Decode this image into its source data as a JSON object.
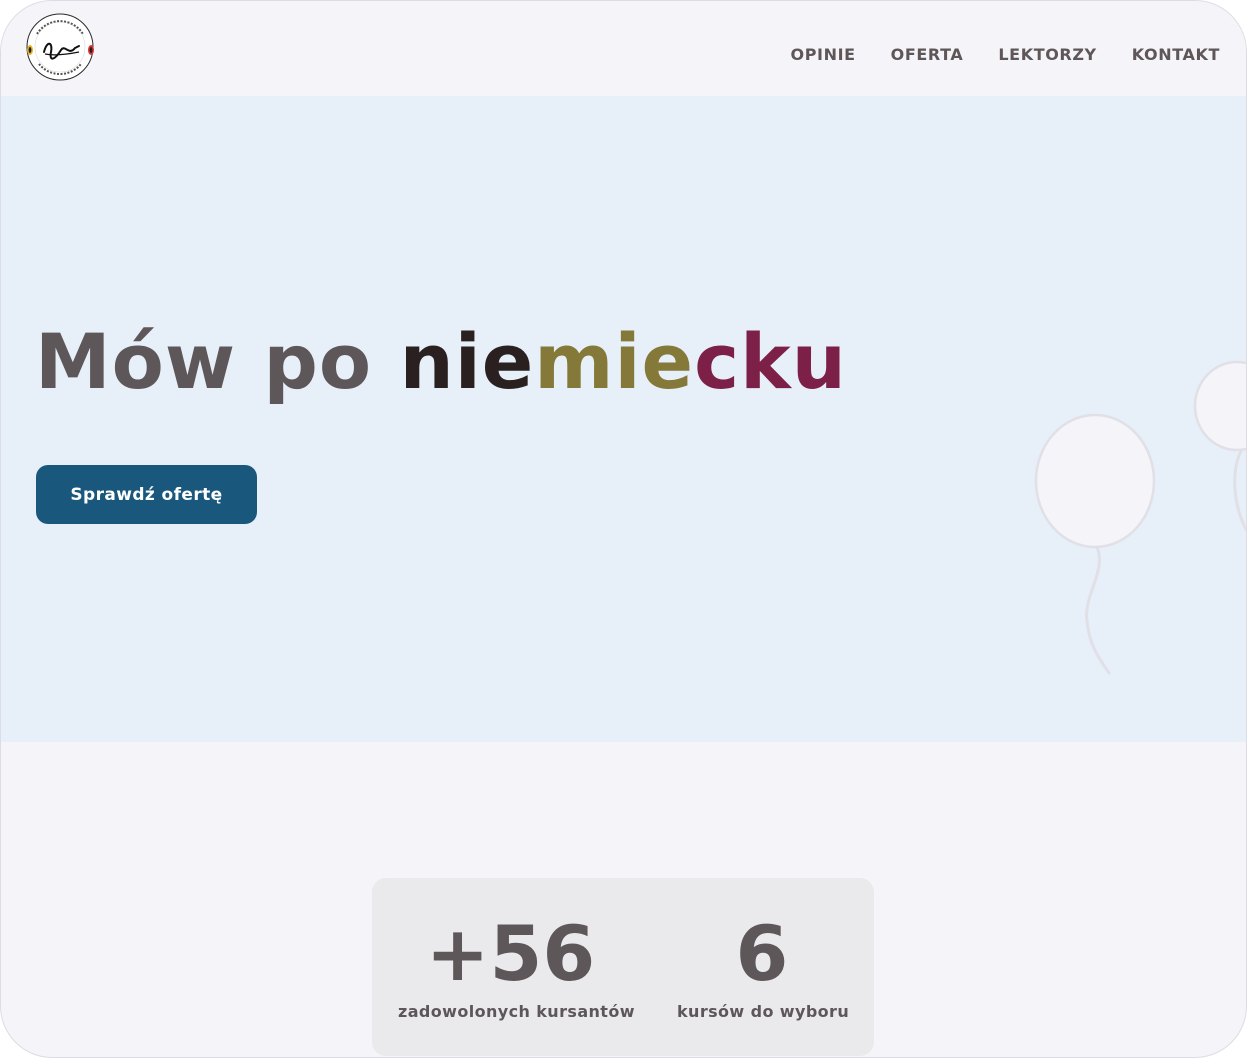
{
  "header": {
    "logo": {
      "text_top": "KURSY PERRY WOLSKIEJ",
      "monogram": "Jpw",
      "text_bottom": "KURSY JĘZYKOWE"
    },
    "nav": [
      "OPINIE",
      "OFERTA",
      "LEKTORZY",
      "KONTAKT"
    ]
  },
  "hero": {
    "headline_start": "Mów po ",
    "headline_part1": "nie",
    "headline_part2": "mie",
    "headline_part3": "cku",
    "cta_label": "Sprawdź ofertę",
    "decoration": "balloon-icons"
  },
  "stats": [
    {
      "value": "+56",
      "label": "zadowolonych kursantów"
    },
    {
      "value": "6",
      "label": "kursów do wyboru"
    }
  ],
  "colors": {
    "accent": "#19587c",
    "text": "#5e5759",
    "flag_black": "#2a2020",
    "flag_gold": "#847938",
    "flag_red": "#7c2047",
    "hero_bg": "#e7eff9",
    "page_bg": "#f4f4f9"
  }
}
